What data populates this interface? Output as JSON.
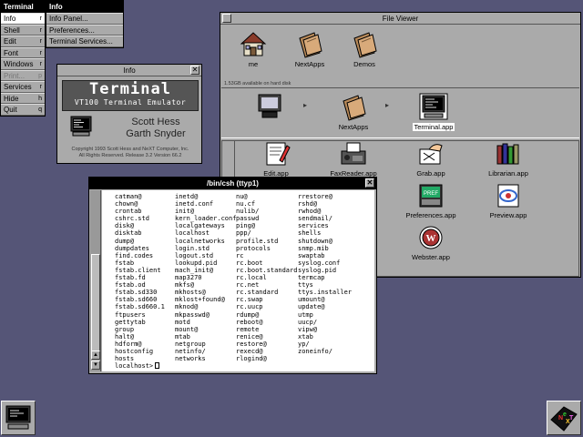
{
  "menus": {
    "main": {
      "title": "Terminal",
      "items": [
        {
          "label": "Info",
          "key": "r",
          "highlighted": true
        },
        {
          "label": "Shell",
          "key": "r"
        },
        {
          "label": "Edit",
          "key": "r"
        },
        {
          "label": "Font",
          "key": "r"
        },
        {
          "label": "Windows",
          "key": "r"
        },
        {
          "label": "Print...",
          "key": "p",
          "disabled": true
        },
        {
          "label": "Services",
          "key": "r"
        },
        {
          "label": "Hide",
          "key": "h"
        },
        {
          "label": "Quit",
          "key": "q"
        }
      ]
    },
    "sub": {
      "title": "Info",
      "items": [
        "Info Panel...",
        "Preferences...",
        "Terminal Services..."
      ]
    }
  },
  "info_panel": {
    "title": "Info",
    "logo_title": "Terminal",
    "logo_subtitle": "VT100 Terminal Emulator",
    "author1": "Scott Hess",
    "author2": "Garth Snyder",
    "fine1": "Copyright 1993 Scott Hess and NeXT Computer, Inc.",
    "fine2": "All Rights Reserved.  Release 3.2  Version 66.2"
  },
  "file_viewer": {
    "title": "File Viewer",
    "shelf": [
      {
        "label": "me",
        "icon": "home-icon"
      },
      {
        "label": "NextApps",
        "icon": "folder-icon"
      },
      {
        "label": "Demos",
        "icon": "folder-icon"
      }
    ],
    "disk_note": "1.53GB available on hard disk",
    "path": [
      {
        "label": "",
        "icon": "computer-icon"
      },
      {
        "label": "NextApps",
        "icon": "folder-icon"
      },
      {
        "label": "Terminal.app",
        "icon": "terminal-icon"
      }
    ],
    "browser": [
      {
        "label": "Edit.app",
        "icon": "edit-icon"
      },
      {
        "label": "FaxReader.app",
        "icon": "fax-icon"
      },
      {
        "label": "Grab.app",
        "icon": "grab-icon"
      },
      {
        "label": "Librarian.app",
        "icon": "librarian-icon"
      },
      {
        "label": "Preferences.app",
        "icon": "preferences-icon"
      },
      {
        "label": "Preview.app",
        "icon": "preview-icon"
      },
      {
        "label": "Webster.app",
        "icon": "webster-icon"
      }
    ]
  },
  "terminal": {
    "title": "/bin/csh  (ttyp1)",
    "columns": [
      [
        "catman@",
        "chown@",
        "crontab",
        "cshrc.std",
        "disk@",
        "disktab",
        "dump@",
        "dumpdates",
        "find.codes",
        "fstab",
        "fstab.client",
        "fstab.fd",
        "fstab.od",
        "fstab.sd330",
        "fstab.sd660",
        "fstab.sd660.1",
        "ftpusers",
        "gettytab",
        "group",
        "halt@",
        "hdform@",
        "hostconfig",
        "hosts"
      ],
      [
        "inetd@",
        "inetd.conf",
        "init@",
        "kern_loader.conf",
        "localgateways",
        "localhost",
        "localnetworks",
        "login.std",
        "logout.std",
        "lookupd.pid",
        "mach_init@",
        "map3270",
        "mkfs@",
        "mkhosts@",
        "mklost+found@",
        "mknod@",
        "mkpasswd@",
        "motd",
        "mount@",
        "mtab",
        "netgroup",
        "netinfo/",
        "networks"
      ],
      [
        "nu@",
        "nu.cf",
        "nulib/",
        "passwd",
        "ping@",
        "ppp/",
        "profile.std",
        "protocols",
        "rc",
        "rc.boot",
        "rc.boot.standard",
        "rc.local",
        "rc.net",
        "rc.standard",
        "rc.swap",
        "rc.uucp",
        "rdump@",
        "reboot@",
        "remote",
        "renice@",
        "restore@",
        "rexecd@",
        "rlogind@"
      ],
      [
        "rrestore@",
        "rshd@",
        "rwhod@",
        "sendmail/",
        "services",
        "shells",
        "shutdown@",
        "snmp.mib",
        "swaptab",
        "syslog.conf",
        "syslog.pid",
        "termcap",
        "ttys",
        "ttys.installer",
        "umount@",
        "update@",
        "utmp",
        "uucp/",
        "vipw@",
        "xtab",
        "yp/",
        "zoneinfo/",
        ""
      ]
    ],
    "prompt": "localhost>"
  },
  "colors": {
    "desktop": "#555577",
    "chrome": "#aaaaaa",
    "titlebar_active": "#000000"
  }
}
